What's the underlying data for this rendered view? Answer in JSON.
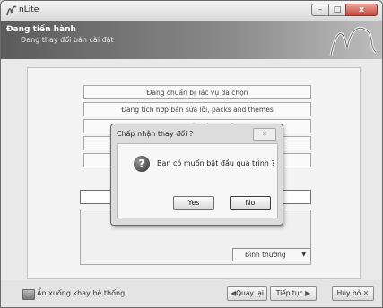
{
  "window": {
    "title": "nLite",
    "minimize_label": "–",
    "maximize_label": "□",
    "close_label": "x"
  },
  "header": {
    "title": "Đang tiến hành",
    "subtitle": "Đang thay đổi bản cài đặt"
  },
  "tasks": [
    "Đang chuẩn bị Tác vụ đã chọn",
    "Đang tích hợp bản sửa lỗi, packs and themes",
    "Đang gỡ bỏ Thành phần",
    "",
    ""
  ],
  "speed_select": {
    "value": "Bình thường"
  },
  "dialog": {
    "title": "Chấp nhận thay đổi ?",
    "close_label": "x",
    "message": "Bạn có muốn bắt đầu quá trình ?",
    "yes_label": "Yes",
    "no_label": "No"
  },
  "footer": {
    "tray_label": "Ẩn xuống khay hệ thống",
    "back_label": "Quay lại",
    "next_label": "Tiếp tục",
    "cancel_label": "Hủy bỏ"
  }
}
